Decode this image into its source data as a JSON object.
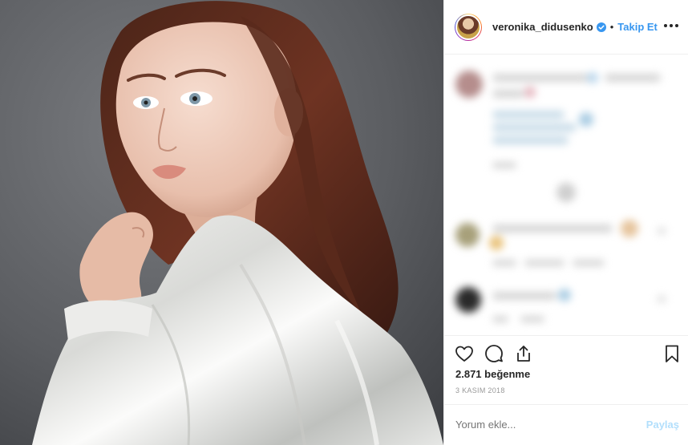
{
  "post": {
    "username": "veronika_didusenko",
    "verified": true,
    "separator": "•",
    "follow_label": "Takip Et",
    "likes_text": "2.871 beğenme",
    "date_text": "3 KASIM 2018"
  },
  "comment_box": {
    "placeholder": "Yorum ekle...",
    "share_label": "Paylaş"
  },
  "icons": {
    "more": "more-options-icon",
    "like": "heart-icon",
    "comment": "comment-icon",
    "share": "share-icon",
    "save": "bookmark-icon",
    "verified": "verified-badge-icon"
  },
  "colors": {
    "link_blue": "#3897f0",
    "share_disabled": "#b2dffc",
    "text": "#262626",
    "muted": "#999999",
    "border": "#efefef"
  }
}
